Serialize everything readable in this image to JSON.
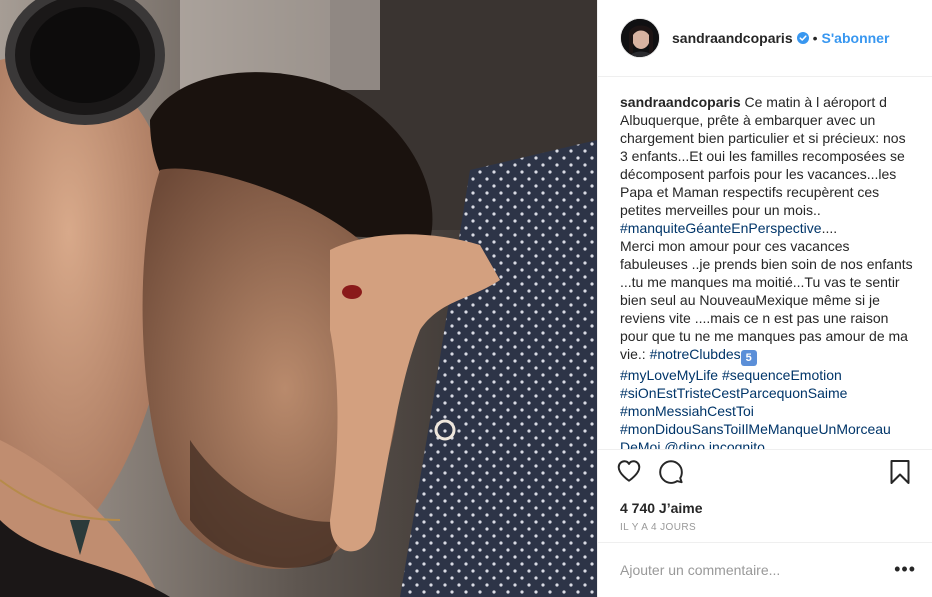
{
  "post": {
    "photo_alt": "",
    "author": {
      "username": "sandraandcoparis",
      "verified": true,
      "separator": "•",
      "follow_label": "S'abonner"
    },
    "caption": {
      "username": "sandraandcoparis",
      "text_1": " Ce matin à l aéroport d Albuquerque, prête à embarquer avec un chargement bien particulier et si précieux: nos 3 enfants...Et oui les familles recomposées se décomposent parfois pour les vacances...les Papa et Maman respectifs recupèrent ces petites merveilles pour un mois.. ",
      "tag_1": "#manquiteGéanteEnPerspective",
      "text_2": "....\nMerci mon amour pour ces vacances fabuleuses ..je prends bien soin de nos enfants ...tu me manques ma moitié...Tu vas te sentir bien seul au NouveauMexique même si je reviens vite ....mais ce n est pas une raison pour que tu ne me manques pas amour de ma vie.: ",
      "tag_2": "#notreClubdes",
      "emoji": "5",
      "tag_3": "#myLoveMyLife",
      "tag_4": "#sequenceEmotion",
      "tag_5": "#siOnEstTristeCestParcequonSaime",
      "tag_6": "#monMessiahCestToi",
      "tag_7": "#monDidouSansToiIlMeManqueUnMorceau DeMoi",
      "mention": "@dino.incognito"
    },
    "likes": "4 740 J’aime",
    "timestamp": "IL Y A 4 JOURS",
    "comment": {
      "placeholder": "Ajouter un commentaire...",
      "more_label": "•••"
    },
    "icons": {
      "like": "heart-icon",
      "comment": "comment-bubble-icon",
      "save": "bookmark-icon",
      "verified": "verified-badge-icon"
    },
    "colors": {
      "link": "#3897f0",
      "hashtag": "#003569",
      "muted": "#999999",
      "text": "#262626",
      "border": "#efefef"
    }
  }
}
